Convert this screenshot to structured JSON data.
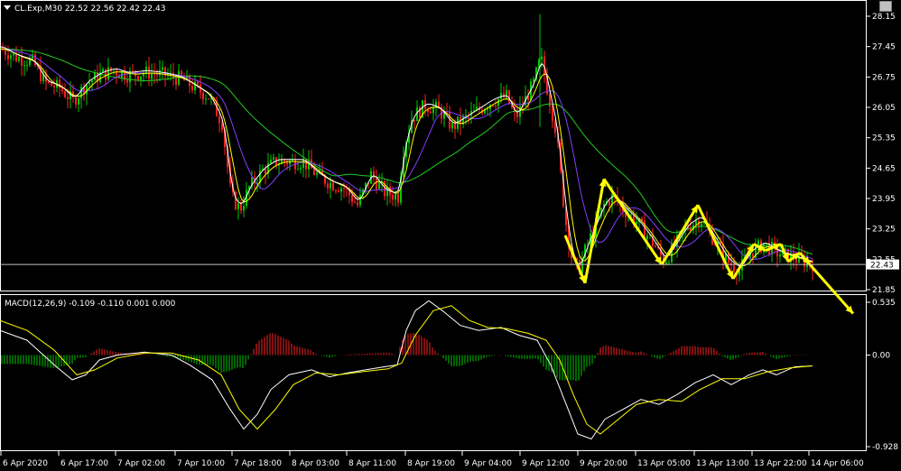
{
  "symbol_header": "CL.Exp,M30  22.52 22.56 22.42 22.43",
  "macd_header": "MACD(12,26,9) -0.109 -0.110 0.001 0.000",
  "current_price": "22.43",
  "colors": {
    "background": "#000000",
    "bull": "#00c800",
    "bear": "#ff2020",
    "grid": "#ffffff",
    "ma_fast": "#ffffff",
    "ma_mid": "#ffff00",
    "ma_slow_purple": "#8040ff",
    "ma_slow_green": "#22cc22",
    "zigzag": "#ffff00",
    "macd_line": "#ffffff",
    "signal_line": "#ffff00"
  },
  "icons": [
    "dropdown-triangle-icon",
    "window-button-icon"
  ],
  "chart_data": [
    {
      "type": "candlestick",
      "ylim": [
        21.5,
        28.4
      ],
      "y_ticks": [
        "28.15",
        "27.45",
        "26.75",
        "26.05",
        "25.35",
        "24.65",
        "23.95",
        "23.25",
        "22.55",
        "21.85"
      ],
      "x_ticks": [
        "6 Apr 2020",
        "6 Apr 17:00",
        "7 Apr 02:00",
        "7 Apr 10:00",
        "7 Apr 18:00",
        "8 Apr 03:00",
        "8 Apr 11:00",
        "8 Apr 19:00",
        "9 Apr 04:00",
        "9 Apr 12:00",
        "9 Apr 20:00",
        "13 Apr 05:00",
        "13 Apr 13:00",
        "13 Apr 22:00",
        "14 Apr 06:00"
      ],
      "current_price": 22.43,
      "close_path": [
        [
          0,
          27.4
        ],
        [
          18,
          27.2
        ],
        [
          35,
          27.1
        ],
        [
          50,
          26.6
        ],
        [
          65,
          26.5
        ],
        [
          80,
          26.2
        ],
        [
          95,
          26.6
        ],
        [
          110,
          26.8
        ],
        [
          125,
          26.9
        ],
        [
          140,
          26.8
        ],
        [
          160,
          26.85
        ],
        [
          180,
          26.8
        ],
        [
          200,
          26.7
        ],
        [
          215,
          26.5
        ],
        [
          230,
          26.3
        ],
        [
          245,
          25.7
        ],
        [
          255,
          24.0
        ],
        [
          265,
          23.7
        ],
        [
          275,
          24.2
        ],
        [
          290,
          24.6
        ],
        [
          305,
          24.8
        ],
        [
          320,
          24.8
        ],
        [
          335,
          24.8
        ],
        [
          350,
          24.5
        ],
        [
          365,
          24.3
        ],
        [
          380,
          24.2
        ],
        [
          395,
          23.8
        ],
        [
          410,
          24.5
        ],
        [
          425,
          24.1
        ],
        [
          440,
          24.0
        ],
        [
          445,
          25.0
        ],
        [
          455,
          25.8
        ],
        [
          470,
          26.1
        ],
        [
          485,
          26.0
        ],
        [
          500,
          25.6
        ],
        [
          515,
          25.8
        ],
        [
          530,
          26.0
        ],
        [
          545,
          26.2
        ],
        [
          560,
          26.3
        ],
        [
          570,
          25.8
        ],
        [
          580,
          26.2
        ],
        [
          590,
          26.6
        ],
        [
          598,
          27.2
        ],
        [
          605,
          26.5
        ],
        [
          615,
          25.5
        ],
        [
          625,
          23.5
        ],
        [
          633,
          22.5
        ],
        [
          640,
          22.3
        ],
        [
          648,
          22.8
        ],
        [
          658,
          23.3
        ],
        [
          668,
          23.8
        ],
        [
          678,
          24.0
        ],
        [
          690,
          23.7
        ],
        [
          705,
          23.4
        ],
        [
          720,
          23.0
        ],
        [
          735,
          22.5
        ],
        [
          748,
          22.9
        ],
        [
          760,
          23.3
        ],
        [
          775,
          23.5
        ],
        [
          790,
          23.0
        ],
        [
          805,
          22.5
        ],
        [
          818,
          22.3
        ],
        [
          830,
          22.7
        ],
        [
          845,
          22.9
        ],
        [
          860,
          22.7
        ],
        [
          875,
          22.6
        ],
        [
          890,
          22.5
        ],
        [
          900,
          22.43
        ]
      ],
      "zigzag": [
        [
          626,
          23.1
        ],
        [
          648,
          22.0
        ],
        [
          669,
          24.4
        ],
        [
          733,
          22.43
        ],
        [
          773,
          23.8
        ],
        [
          812,
          22.1
        ],
        [
          835,
          22.9
        ],
        [
          848,
          22.75
        ],
        [
          865,
          22.9
        ],
        [
          873,
          22.5
        ],
        [
          886,
          22.7
        ],
        [
          897,
          22.43
        ],
        [
          945,
          21.3
        ]
      ]
    },
    {
      "type": "macd",
      "ylim": [
        -0.928,
        0.535
      ],
      "y_ticks": [
        "0.535",
        "0.00",
        "-0.928"
      ],
      "macd_line": [
        [
          0,
          0.25
        ],
        [
          30,
          0.15
        ],
        [
          60,
          -0.1
        ],
        [
          80,
          -0.25
        ],
        [
          95,
          -0.2
        ],
        [
          110,
          -0.05
        ],
        [
          130,
          0.0
        ],
        [
          160,
          0.03
        ],
        [
          190,
          0.0
        ],
        [
          210,
          -0.1
        ],
        [
          235,
          -0.25
        ],
        [
          255,
          -0.55
        ],
        [
          270,
          -0.75
        ],
        [
          285,
          -0.6
        ],
        [
          300,
          -0.35
        ],
        [
          320,
          -0.2
        ],
        [
          345,
          -0.15
        ],
        [
          365,
          -0.22
        ],
        [
          385,
          -0.18
        ],
        [
          405,
          -0.15
        ],
        [
          425,
          -0.12
        ],
        [
          440,
          -0.1
        ],
        [
          450,
          0.25
        ],
        [
          460,
          0.45
        ],
        [
          475,
          0.55
        ],
        [
          490,
          0.45
        ],
        [
          510,
          0.3
        ],
        [
          530,
          0.25
        ],
        [
          555,
          0.28
        ],
        [
          575,
          0.2
        ],
        [
          595,
          0.15
        ],
        [
          610,
          -0.1
        ],
        [
          625,
          -0.45
        ],
        [
          640,
          -0.8
        ],
        [
          655,
          -0.85
        ],
        [
          670,
          -0.65
        ],
        [
          690,
          -0.55
        ],
        [
          710,
          -0.45
        ],
        [
          730,
          -0.5
        ],
        [
          750,
          -0.4
        ],
        [
          770,
          -0.28
        ],
        [
          790,
          -0.2
        ],
        [
          810,
          -0.3
        ],
        [
          830,
          -0.2
        ],
        [
          845,
          -0.15
        ],
        [
          860,
          -0.2
        ],
        [
          880,
          -0.12
        ],
        [
          900,
          -0.11
        ]
      ],
      "signal_line": [
        [
          0,
          0.35
        ],
        [
          30,
          0.25
        ],
        [
          60,
          0.05
        ],
        [
          85,
          -0.2
        ],
        [
          105,
          -0.15
        ],
        [
          130,
          -0.03
        ],
        [
          160,
          0.02
        ],
        [
          190,
          0.02
        ],
        [
          220,
          -0.05
        ],
        [
          245,
          -0.2
        ],
        [
          265,
          -0.55
        ],
        [
          285,
          -0.75
        ],
        [
          305,
          -0.55
        ],
        [
          325,
          -0.3
        ],
        [
          350,
          -0.18
        ],
        [
          375,
          -0.2
        ],
        [
          400,
          -0.17
        ],
        [
          430,
          -0.14
        ],
        [
          445,
          -0.08
        ],
        [
          460,
          0.2
        ],
        [
          480,
          0.45
        ],
        [
          500,
          0.5
        ],
        [
          520,
          0.35
        ],
        [
          540,
          0.28
        ],
        [
          560,
          0.27
        ],
        [
          585,
          0.22
        ],
        [
          605,
          0.15
        ],
        [
          620,
          -0.05
        ],
        [
          635,
          -0.4
        ],
        [
          650,
          -0.7
        ],
        [
          665,
          -0.8
        ],
        [
          685,
          -0.65
        ],
        [
          705,
          -0.5
        ],
        [
          730,
          -0.45
        ],
        [
          755,
          -0.47
        ],
        [
          775,
          -0.35
        ],
        [
          800,
          -0.24
        ],
        [
          825,
          -0.24
        ],
        [
          850,
          -0.17
        ],
        [
          875,
          -0.13
        ],
        [
          900,
          -0.11
        ]
      ]
    }
  ]
}
